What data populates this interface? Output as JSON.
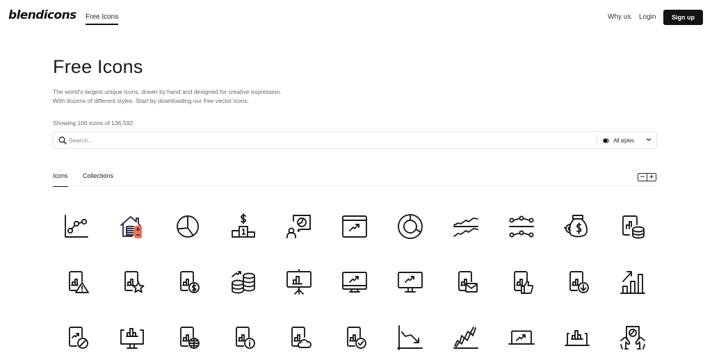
{
  "header": {
    "logo": "blendicons",
    "nav_active": "Free Icons",
    "why_us": "Why us",
    "login": "Login",
    "signup": "Sign up"
  },
  "hero": {
    "title": "Free Icons",
    "description_line1": "The world's largest unique icons, drawn by hand and designed for creative expression.",
    "description_line2": "With dozens of different styles. Start by downloading our free vector icons.",
    "count_text": "Showing 100 icons of 136,592"
  },
  "search": {
    "placeholder": "Search...",
    "value": "",
    "style_filter": "All styles"
  },
  "tabs": [
    {
      "label": "Icons",
      "active": true
    },
    {
      "label": "Collections",
      "active": false
    }
  ],
  "zoom_controls": {
    "minus": "−",
    "plus": "+"
  },
  "colors": {
    "accent": "#141414",
    "icon_accent": "#f0714f",
    "text_muted": "#666666"
  },
  "icons": [
    [
      "line-chart-dots-icon",
      "house-calculator-icon",
      "pie-chart-icon",
      "podium-dollar-icon",
      "presentation-speaker-icon",
      "browser-trend-up-icon",
      "donut-chart-icon",
      "wave-lines-compare-icon",
      "slider-nodes-icon",
      "money-bag-magnet-icon",
      "report-coins-icon"
    ],
    [
      "report-warning-icon",
      "report-star-icon",
      "report-dollar-icon",
      "coins-growth-icon",
      "presentation-board-chart-icon",
      "monitor-trend-icon",
      "desktop-trend-icon",
      "report-mail-icon",
      "report-like-icon",
      "report-download-icon",
      "bar-chart-growth-icon"
    ],
    [
      "report-blocked-icon",
      "monitor-bar-chart-icon",
      "report-globe-icon",
      "report-info-icon",
      "report-cloud-icon",
      "report-check-icon",
      "line-chart-decline-icon",
      "volatile-chart-icon",
      "laptop-trend-icon",
      "bar-chart-box-icon",
      "hands-report-icon"
    ]
  ]
}
